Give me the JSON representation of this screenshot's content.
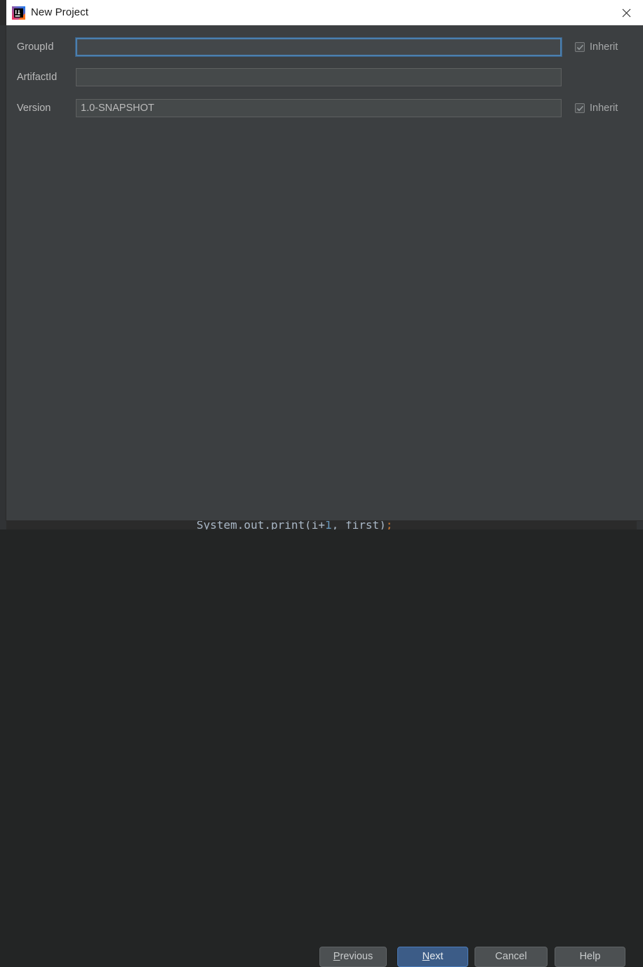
{
  "window": {
    "title": "New Project",
    "icon": "intellij-idea-logo",
    "close_icon": "close-icon"
  },
  "form": {
    "rows": [
      {
        "label": "GroupId",
        "value": "",
        "placeholder": "",
        "focused": true,
        "has_inherit": true,
        "inherit_label": "Inherit",
        "inherit_checked": true
      },
      {
        "label": "ArtifactId",
        "value": "",
        "placeholder": "",
        "focused": false,
        "has_inherit": false,
        "inherit_label": "",
        "inherit_checked": false
      },
      {
        "label": "Version",
        "value": "1.0-SNAPSHOT",
        "placeholder": "",
        "focused": false,
        "has_inherit": true,
        "inherit_label": "Inherit",
        "inherit_checked": true
      }
    ]
  },
  "buttons": {
    "previous": {
      "prefix": "",
      "mnemonic": "P",
      "suffix": "revious"
    },
    "next": {
      "prefix": "",
      "mnemonic": "N",
      "suffix": "ext",
      "default": true
    },
    "cancel": {
      "prefix": "",
      "mnemonic": "",
      "suffix": "Cancel"
    },
    "help": {
      "prefix": "",
      "mnemonic": "",
      "suffix": "Help"
    }
  },
  "background_ide": {
    "code_fragment": "System.out.print(i+1, first);",
    "code_part_1": "System.out.print(i+",
    "code_part_2": "1",
    "code_part_3": ", first)",
    "code_part_4": ";"
  },
  "colors": {
    "dialog_background": "#3c3f41",
    "titlebar_background": "#ffffff",
    "label_text": "#bbbbbb",
    "field_background": "#45494a",
    "focus_ring": "#4b7fae",
    "default_button": "#3c5c87",
    "button_background": "#4c5052",
    "ide_background": "#2b2b2b"
  }
}
